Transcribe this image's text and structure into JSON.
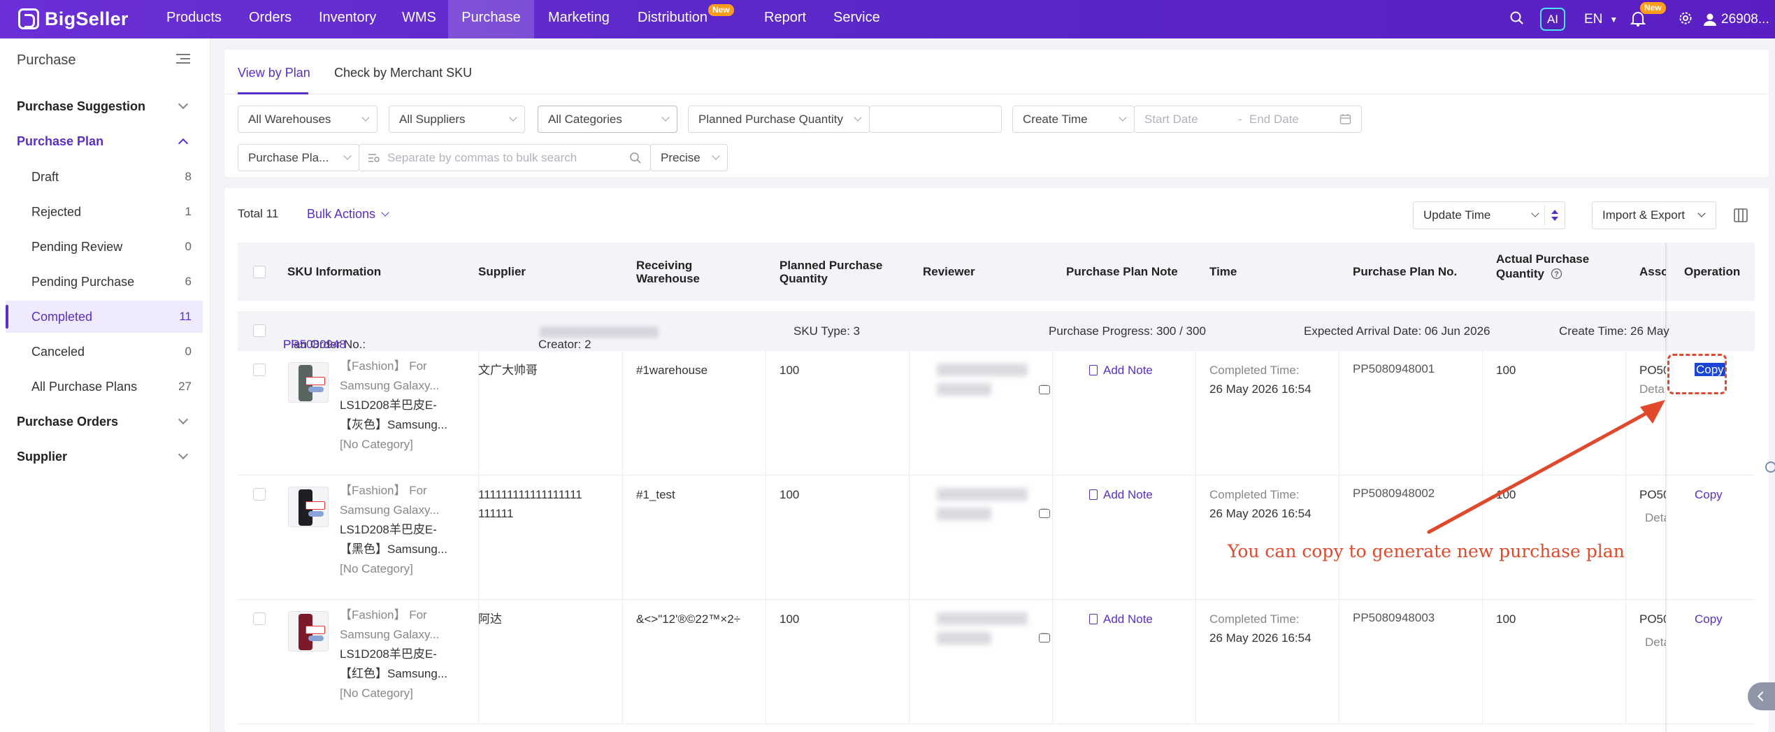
{
  "topbar": {
    "brand": "BigSeller",
    "nav": [
      "Products",
      "Orders",
      "Inventory",
      "WMS",
      "Purchase",
      "Marketing",
      "Distribution",
      "Report",
      "Service"
    ],
    "active_nav": "Purchase",
    "new_badge": "New",
    "ai_label": "AI",
    "lang": "EN",
    "notif_badge": "New",
    "user": "26908..."
  },
  "sidebar": {
    "title": "Purchase",
    "groups": [
      {
        "label": "Purchase Suggestion"
      },
      {
        "label": "Purchase Plan"
      },
      {
        "label": "Purchase Orders"
      },
      {
        "label": "Supplier"
      }
    ],
    "plan_items": [
      {
        "label": "Draft",
        "count": "8"
      },
      {
        "label": "Rejected",
        "count": "1"
      },
      {
        "label": "Pending Review",
        "count": "0"
      },
      {
        "label": "Pending Purchase",
        "count": "6"
      },
      {
        "label": "Completed",
        "count": "11"
      },
      {
        "label": "Canceled",
        "count": "0"
      },
      {
        "label": "All Purchase Plans",
        "count": "27"
      }
    ]
  },
  "tabs": [
    "View by Plan",
    "Check by Merchant SKU"
  ],
  "filters": {
    "warehouses": "All Warehouses",
    "suppliers": "All Suppliers",
    "categories": "All Categories",
    "planned_qty": "Planned Purchase Quantity",
    "create_time": "Create Time",
    "start_date": "Start Date",
    "date_sep": "-",
    "end_date": "End Date",
    "search_field": "Purchase Pla...",
    "search_placeholder": "Separate by commas to bulk search",
    "match": "Precise"
  },
  "list": {
    "total": "Total 11",
    "bulk_actions": "Bulk Actions",
    "sort": "Update Time",
    "import_export": "Import & Export",
    "headers": {
      "sku": "SKU Information",
      "supplier": "Supplier",
      "warehouse_1": "Receiving",
      "warehouse_2": "Warehouse",
      "planned_1": "Planned Purchase",
      "planned_2": "Quantity",
      "reviewer": "Reviewer",
      "note": "Purchase Plan Note",
      "time": "Time",
      "plan_no": "Purchase Plan No.",
      "actual_1": "Actual Purchase",
      "actual_2": "Quantity",
      "assoc": "Asso",
      "operation": "Operation"
    },
    "plan_info": {
      "order_label": "Plan Order No.: ",
      "order_no": "PR5080948",
      "creator": "Creator: 2",
      "sku_type": "SKU Type: 3",
      "progress": "Purchase Progress: 300 / 300",
      "arrival": "Expected Arrival Date: 06 Jun 2026",
      "create_time": "Create Time: 26 May"
    },
    "rows": [
      {
        "title": "【Fashion】 For",
        "title2": "Samsung Galaxy...",
        "sku": "LS1D208羊巴皮E-",
        "sku2": "【灰色】Samsung...",
        "category": "[No Category]",
        "supplier": "文广大帅哥",
        "supplier2": "",
        "warehouse": "#1warehouse",
        "planned": "100",
        "note": "Add Note",
        "time_label": "Completed Time:",
        "time": "26 May 2026 16:54",
        "plan_no": "PP5080948001",
        "actual": "100",
        "assoc": "PO50",
        "assoc2": "Deta",
        "op": "Copy"
      },
      {
        "title": "【Fashion】 For",
        "title2": "Samsung Galaxy...",
        "sku": "LS1D208羊巴皮E-",
        "sku2": "【黑色】Samsung...",
        "category": "[No Category]",
        "supplier": "111111111111111111",
        "supplier2": "111111",
        "warehouse": "#1_test",
        "planned": "100",
        "note": "Add Note",
        "time_label": "Completed Time:",
        "time": "26 May 2026 16:54",
        "plan_no": "PP5080948002",
        "actual": "100",
        "assoc": "PO50",
        "assoc2": "Deta",
        "op": "Copy"
      },
      {
        "title": "【Fashion】 For",
        "title2": "Samsung Galaxy...",
        "sku": "LS1D208羊巴皮E-",
        "sku2": "【红色】Samsung...",
        "category": "[No Category]",
        "supplier": "阿达",
        "supplier2": "",
        "warehouse": "&<>\"12'®©22™×2÷",
        "planned": "100",
        "note": "Add Note",
        "time_label": "Completed Time:",
        "time": "26 May 2026 16:54",
        "plan_no": "PP5080948003",
        "actual": "100",
        "assoc": "PO50",
        "assoc2": "Deta",
        "op": "Copy"
      }
    ]
  },
  "annotation": "You can copy to generate new purchase plan",
  "colors": {
    "brand": "#5a2fc8",
    "topbar": "#6a2fd6",
    "annotation": "#e0492b",
    "highlight": "#1a44d6"
  }
}
